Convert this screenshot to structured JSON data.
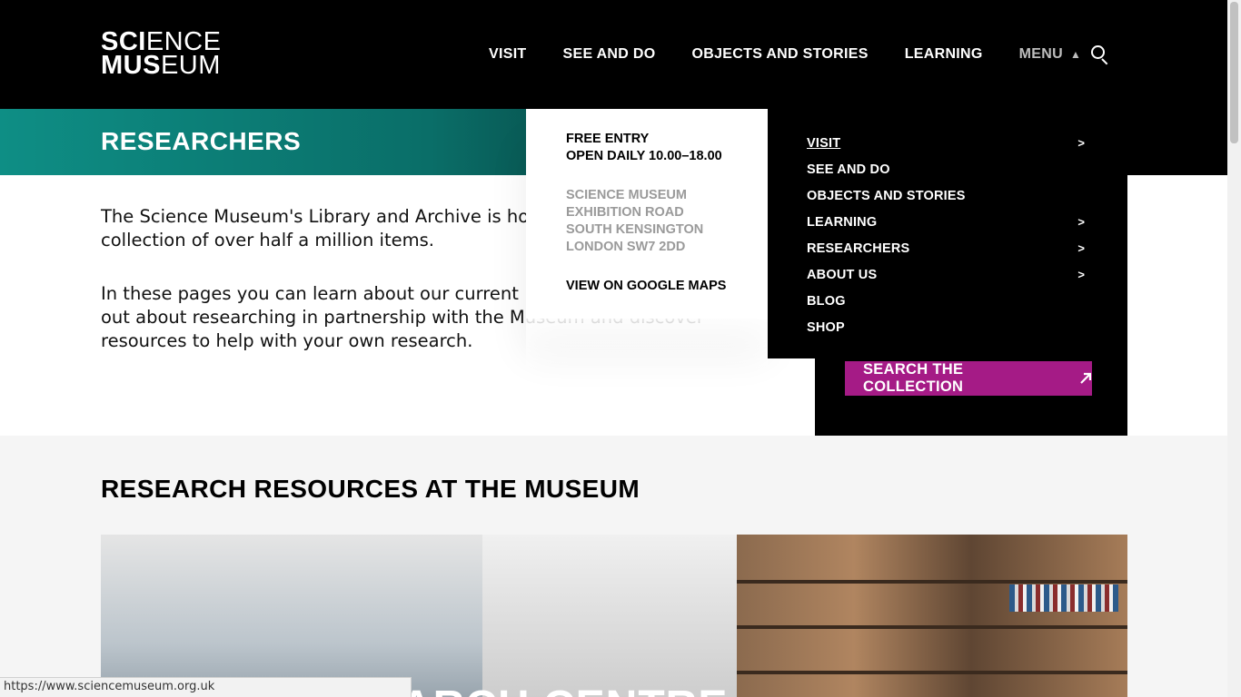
{
  "header": {
    "logo_line1_bold": "SCI",
    "logo_line1_thin": "ENCE",
    "logo_line2_bold": "MUS",
    "logo_line2_thin": "EUM",
    "nav": [
      {
        "label": "VISIT"
      },
      {
        "label": "SEE AND DO"
      },
      {
        "label": "OBJECTS AND STORIES"
      },
      {
        "label": "LEARNING"
      }
    ],
    "menu_label": "MENU",
    "menu_arrow_icon": "triangle-up-icon",
    "search_icon": "search-icon"
  },
  "page": {
    "title": "RESEARCHERS",
    "intro_p1": "The Science Museum's Library and Archive is ho",
    "intro_p1_line2": "collection of over half a million items.",
    "intro_p2_line1": "In these pages you can learn about our current",
    "intro_p2_line2": "out about researching in partnership with the Museum and discover",
    "intro_p2_line3": "resources to help with your own research.",
    "search_collection_label": "SEARCH THE COLLECTION",
    "search_collection_icon": "external-arrow-icon"
  },
  "section": {
    "heading": "RESEARCH RESOURCES AT THE MUSEUM",
    "hero_caption": "ARCH CENTRE"
  },
  "dropdown": {
    "hours_line1": "FREE ENTRY",
    "hours_line2": "OPEN DAILY 10.00–18.00",
    "address": [
      "SCIENCE MUSEUM",
      "EXHIBITION ROAD",
      "SOUTH KENSINGTON",
      "LONDON SW7 2DD"
    ],
    "maps_link": "VIEW ON GOOGLE MAPS",
    "menu_items": [
      {
        "label": "VISIT",
        "chevron": ">"
      },
      {
        "label": "SEE AND DO",
        "chevron": ""
      },
      {
        "label": "OBJECTS AND STORIES",
        "chevron": ""
      },
      {
        "label": "LEARNING",
        "chevron": ">"
      },
      {
        "label": "RESEARCHERS",
        "chevron": ">"
      },
      {
        "label": "ABOUT US",
        "chevron": ">"
      },
      {
        "label": "BLOG",
        "chevron": ""
      },
      {
        "label": "SHOP",
        "chevron": ""
      }
    ]
  },
  "statusbar": {
    "url": "https://www.sciencemuseum.org.uk"
  },
  "colors": {
    "header_bg": "#000000",
    "band_teal": "#0e8e85",
    "accent_magenta": "#a51b86",
    "address_grey": "#9a9a9a"
  }
}
